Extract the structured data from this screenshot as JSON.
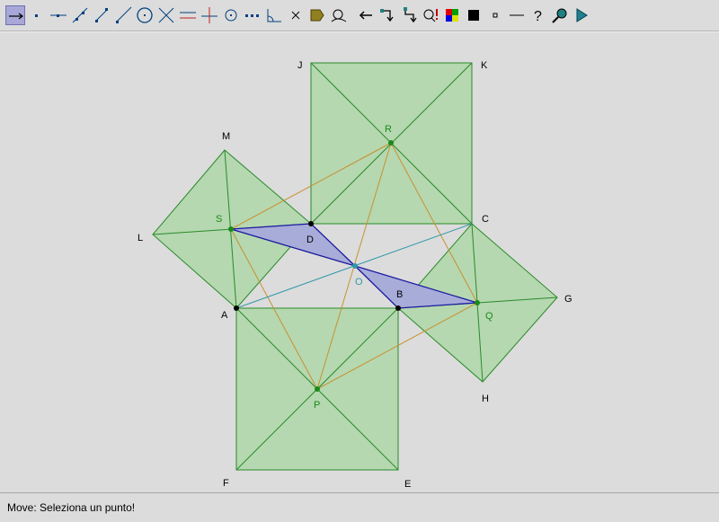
{
  "toolbar": {
    "tools": [
      {
        "icon": "move-arrow-icon",
        "selected": true
      },
      {
        "icon": "new-point-icon"
      },
      {
        "icon": "point-on-line-icon"
      },
      {
        "icon": "line-through-two-points-icon"
      },
      {
        "icon": "segment-icon"
      },
      {
        "icon": "ray-icon"
      },
      {
        "icon": "circle-icon"
      },
      {
        "icon": "intersect-icon"
      },
      {
        "icon": "parallel-line-icon"
      },
      {
        "icon": "perpendicular-line-icon"
      },
      {
        "icon": "midpoint-icon"
      },
      {
        "icon": "dotted-line-icon"
      },
      {
        "icon": "angle-icon"
      },
      {
        "icon": "delete-icon"
      },
      {
        "icon": "polygon-fill-icon"
      },
      {
        "icon": "locus-icon"
      },
      {
        "icon": "undo-arrow-icon"
      },
      {
        "icon": "macro-icon"
      },
      {
        "icon": "macro-run-icon"
      },
      {
        "icon": "magnifier-alert-icon"
      },
      {
        "icon": "color-palette-icon"
      },
      {
        "icon": "black-square-icon"
      },
      {
        "icon": "small-square-icon"
      },
      {
        "icon": "thin-line-icon"
      },
      {
        "icon": "help-question-icon"
      },
      {
        "icon": "zoom-icon"
      },
      {
        "icon": "play-icon"
      }
    ]
  },
  "labels": {
    "J": "J",
    "K": "K",
    "M": "M",
    "R": "R",
    "S": "S",
    "D": "D",
    "C": "C",
    "L": "L",
    "O": "O",
    "B": "B",
    "G": "G",
    "A": "A",
    "Q": "Q",
    "P": "P",
    "H": "H",
    "F": "F",
    "E": "E"
  },
  "colors": {
    "square_fill": "#b5d8b0",
    "square_stroke": "#2a8a2a",
    "triangle_fill": "#a8acd8",
    "triangle_stroke": "#1a1aa0",
    "orange_lines": "#c89030",
    "teal_lines": "#3098a8",
    "green_point": "#1a8a1a",
    "black_point": "#000000"
  },
  "status": {
    "text": "Move: Seleziona un punto!"
  }
}
